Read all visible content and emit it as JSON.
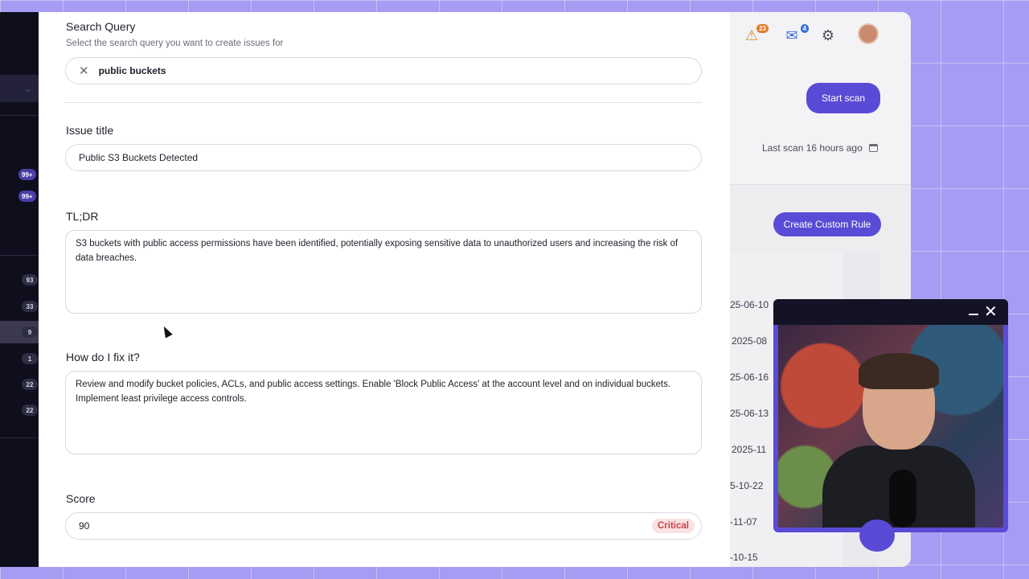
{
  "sidebar": {
    "chevron": "⌄",
    "badges_top": [
      "99+",
      "99+"
    ],
    "badges_counts": [
      "93",
      "33",
      "9",
      "1",
      "22",
      "22"
    ]
  },
  "header": {
    "alert_count": "23",
    "mail_count": "4"
  },
  "actions": {
    "start_scan": "Start scan",
    "last_scan": "Last scan 16 hours ago",
    "create_rule": "Create Custom Rule"
  },
  "table": {
    "dates": [
      "25-06-10",
      "2025-08",
      "25-06-16",
      "25-06-13",
      "2025-11",
      "5-10-22",
      "-11-07",
      "-10-15"
    ]
  },
  "form": {
    "search_query_label": "Search Query",
    "search_query_help": "Select the search query you want to create issues for",
    "search_query_value": "public buckets",
    "issue_title_label": "Issue title",
    "issue_title_value": "Public S3 Buckets Detected",
    "tldr_label": "TL;DR",
    "tldr_value": "S3 buckets with public access permissions have been identified, potentially exposing sensitive data to unauthorized users and increasing the risk of data breaches.",
    "fix_label": "How do I fix it?",
    "fix_value": "Review and modify bucket policies, ACLs, and public access settings. Enable 'Block Public Access' at the account level and on individual buckets. Implement least privilege access controls.",
    "score_label": "Score",
    "score_value": "90",
    "severity": "Critical"
  },
  "icons": {
    "remove": "✕",
    "alert": "⚠",
    "mail": "✉",
    "settings": "⚙",
    "close": "✕"
  },
  "colors": {
    "accent": "#5a4bd6",
    "critical_bg": "#fbe1e2",
    "critical_text": "#c64448"
  }
}
